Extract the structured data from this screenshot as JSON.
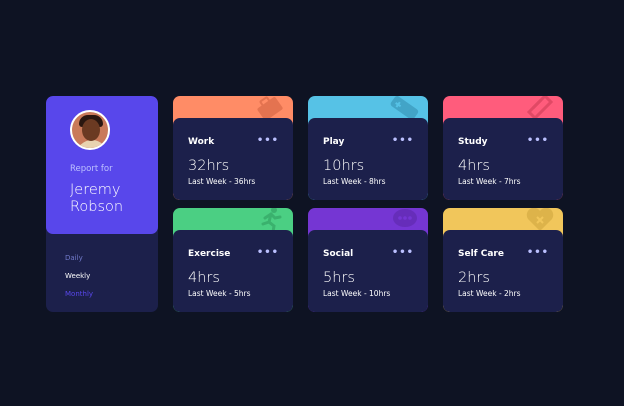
{
  "profile": {
    "report_for": "Report for",
    "name": "Jeremy Robson",
    "avatar_icon": "avatar-photo"
  },
  "periods": [
    {
      "label": "Daily",
      "active": false
    },
    {
      "label": "Weekly",
      "active": true
    },
    {
      "label": "Monthly",
      "active": false
    }
  ],
  "cards": [
    {
      "title": "Work",
      "current": "32hrs",
      "previous": "Last Week - 36hrs",
      "color": "#ff8c66",
      "icon": "briefcase-icon",
      "menu": "•••"
    },
    {
      "title": "Play",
      "current": "10hrs",
      "previous": "Last Week - 8hrs",
      "color": "#56c2e6",
      "icon": "gamepad-icon",
      "menu": "•••"
    },
    {
      "title": "Study",
      "current": "4hrs",
      "previous": "Last Week - 7hrs",
      "color": "#ff5c7c",
      "icon": "book-icon",
      "menu": "•••"
    },
    {
      "title": "Exercise",
      "current": "4hrs",
      "previous": "Last Week - 5hrs",
      "color": "#4bcf83",
      "icon": "running-icon",
      "menu": "•••"
    },
    {
      "title": "Social",
      "current": "5hrs",
      "previous": "Last Week - 10hrs",
      "color": "#7536d3",
      "icon": "chat-icon",
      "menu": "•••"
    },
    {
      "title": "Self Care",
      "current": "2hrs",
      "previous": "Last Week - 2hrs",
      "color": "#f1c65b",
      "icon": "heart-icon",
      "menu": "•••"
    }
  ],
  "colors": {
    "background": "#0e1323",
    "card": "#1c204b",
    "accent": "#5847eb"
  }
}
